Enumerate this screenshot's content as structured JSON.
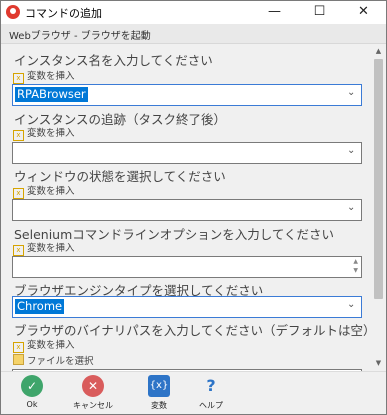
{
  "window": {
    "title": "コマンドの追加",
    "subtitle": "Webブラウザ - ブラウザを起動",
    "controls": {
      "minimize": "—",
      "maximize": "☐",
      "close": "✕"
    }
  },
  "form": {
    "instance_label": "インスタンス名を入力してください",
    "instance_insert": "変数を挿入",
    "instance_value": "RPABrowser",
    "tracking_label": "インスタンスの追跡（タスク終了後）",
    "tracking_insert": "変数を挿入",
    "window_state_label": "ウィンドウの状態を選択してください",
    "window_state_insert": "変数を挿入",
    "selenium_label": "Seleniumコマンドラインオプションを入力してください",
    "selenium_insert": "変数を挿入",
    "engine_label": "ブラウザエンジンタイプを選択してください",
    "engine_value": "Chrome",
    "binary_label": "ブラウザのバイナリパスを入力してください（デフォルトは空）",
    "binary_insert": "変数を挿入",
    "binary_file": "ファイルを選択"
  },
  "buttons": {
    "ok": "Ok",
    "cancel": "キャンセル",
    "variable": "変数",
    "variable_icon": "{x}",
    "help": "ヘルプ",
    "help_icon": "?"
  },
  "icons": {
    "ok": "check-icon",
    "cancel": "x-icon",
    "variable": "variable-icon",
    "help": "question-icon"
  }
}
